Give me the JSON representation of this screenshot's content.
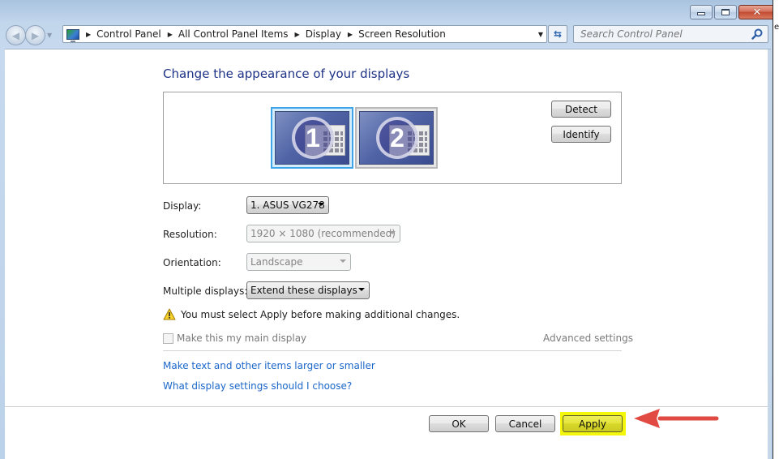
{
  "window": {
    "controls": {
      "minimize": "minimize",
      "maximize": "maximize",
      "close": "close"
    }
  },
  "nav": {
    "back_icon": "back-arrow-icon",
    "forward_icon": "forward-arrow-icon",
    "recent_pages_icon": "chevron-down-icon"
  },
  "address_bar": {
    "icon": "control-panel-icon",
    "breadcrumbs": [
      "Control Panel",
      "All Control Panel Items",
      "Display",
      "Screen Resolution"
    ],
    "separator": "▶",
    "dropdown_glyph": "▼"
  },
  "refresh": {
    "glyph": "⇆"
  },
  "search": {
    "placeholder": "Search Control Panel",
    "value": ""
  },
  "right_edge": {
    "char": "e"
  },
  "main": {
    "title": "Change the appearance of your displays",
    "monitors": [
      {
        "number": "1",
        "selected": true
      },
      {
        "number": "2",
        "selected": false
      }
    ],
    "detect_label": "Detect",
    "identify_label": "Identify",
    "fields": {
      "display": {
        "label": "Display:",
        "value": "1. ASUS VG278",
        "enabled": true
      },
      "resolution": {
        "label": "Resolution:",
        "value": "1920 × 1080 (recommended)",
        "enabled": false
      },
      "orientation": {
        "label": "Orientation:",
        "value": "Landscape",
        "enabled": false
      },
      "multiple_displays": {
        "label": "Multiple displays:",
        "value": "Extend these displays",
        "enabled": true
      }
    },
    "warning": "You must select Apply before making additional changes.",
    "main_display_checkbox": {
      "label": "Make this my main display",
      "checked": false,
      "enabled": false
    },
    "advanced_settings": "Advanced settings",
    "links": [
      "Make text and other items larger or smaller",
      "What display settings should I choose?"
    ],
    "buttons": {
      "ok": "OK",
      "cancel": "Cancel",
      "apply": "Apply"
    },
    "annotation": {
      "highlight_color": "#f4f60c",
      "arrow_color": "#e04a42"
    }
  }
}
